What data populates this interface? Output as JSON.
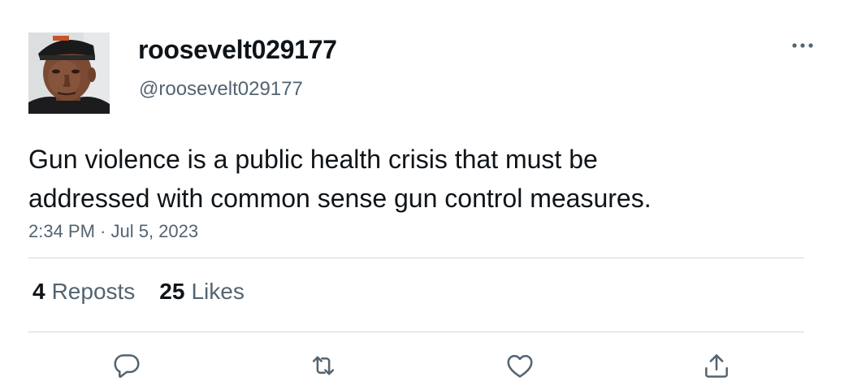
{
  "author": {
    "display_name": "roosevelt029177",
    "handle": "@roosevelt029177",
    "avatar_icon": "profile-photo"
  },
  "tweet": {
    "text_lines": [
      "Gun violence is a public health crisis that must be",
      "addressed with common sense gun control measures."
    ],
    "timestamp": "2:34 PM · Jul 5, 2023"
  },
  "stats": {
    "reposts_count": "4",
    "reposts_label": "Reposts",
    "likes_count": "25",
    "likes_label": "Likes"
  },
  "actions": {
    "more_icon": "more-horizontal-icon",
    "reply_icon": "reply-icon",
    "repost_icon": "repost-icon",
    "like_icon": "like-icon",
    "share_icon": "share-icon"
  },
  "colors": {
    "text_primary": "#0f1419",
    "text_secondary": "#536471",
    "divider": "#cfd9de"
  }
}
